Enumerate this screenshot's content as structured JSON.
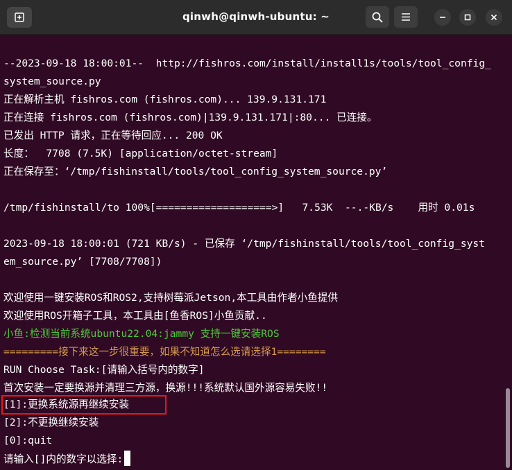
{
  "window": {
    "title": "qinwh@qinwh-ubuntu: ~",
    "icons": {
      "new_tab": "new-tab-icon",
      "search": "search-icon",
      "menu": "hamburger-menu-icon",
      "minimize": "minimize-icon",
      "maximize": "maximize-icon",
      "close": "close-icon"
    }
  },
  "terminal": {
    "lines": [
      "--2023-09-18 18:00:01--  http://fishros.com/install/install1s/tools/tool_config_",
      "system_source.py",
      "正在解析主机 fishros.com (fishros.com)... 139.9.131.171",
      "正在连接 fishros.com (fishros.com)|139.9.131.171|:80... 已连接。",
      "已发出 HTTP 请求，正在等待回应... 200 OK",
      "长度：  7708 (7.5K) [application/octet-stream]",
      "正在保存至：‘/tmp/fishinstall/tools/tool_config_system_source.py’",
      "",
      "/tmp/fishinstall/to 100%[===================>]   7.53K  --.-KB/s    用时 0.01s",
      "",
      "2023-09-18 18:00:01 (721 KB/s) - 已保存 ‘/tmp/fishinstall/tools/tool_config_syst",
      "em_source.py’ [7708/7708])",
      "",
      "欢迎使用一键安装ROS和ROS2,支持树莓派Jetson,本工具由作者小鱼提供",
      "欢迎使用ROS开箱子工具，本工具由[鱼香ROS]小鱼贡献..",
      "小鱼:检测当前系统ubuntu22.04:jammy 支持一键安装ROS",
      "=========接下来这一步很重要，如果不知道怎么选请选择1========",
      "RUN Choose Task:[请输入括号内的数字]",
      "首次安装一定要换源并清理三方源，换源!!!系统默认国外源容易失败!!",
      "[1]:更换系统源再继续安装",
      "[2]:不更换继续安装",
      "[0]:quit",
      "请输入[]内的数字以选择:"
    ],
    "colors": {
      "background": "#300a24",
      "text": "#ffffff",
      "green": "#4ec93a",
      "orange": "#d59a4d",
      "highlight_border": "#e4191b"
    }
  }
}
